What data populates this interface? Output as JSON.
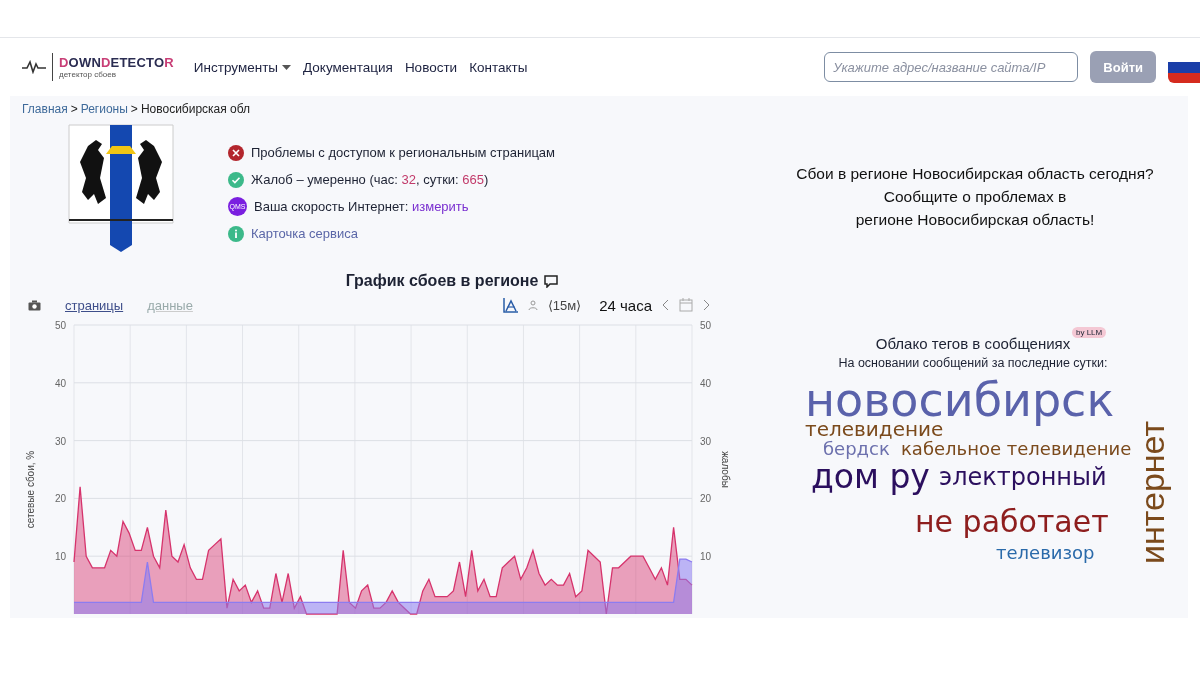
{
  "logo": {
    "name": "DOWNDETECTOR",
    "tagline": "детектор сбоев"
  },
  "nav": [
    {
      "label": "Инструменты",
      "dropdown": true
    },
    {
      "label": "Документация",
      "dropdown": false
    },
    {
      "label": "Новости",
      "dropdown": false
    },
    {
      "label": "Контакты",
      "dropdown": false
    }
  ],
  "search": {
    "placeholder": "Укажите адрес/название сайта/IP"
  },
  "login_button": "Войти",
  "breadcrumb": {
    "separator": ">",
    "items": [
      "Главная",
      "Регионы",
      "Новосибирская обл"
    ]
  },
  "status_items": [
    {
      "kind": "error",
      "label": "Проблемы с доступом к региональным страницам"
    },
    {
      "kind": "ok",
      "label": "Жалоб – умеренно (час: ",
      "hour": "32",
      "day_label": ", сутки: ",
      "day": "665",
      "close": ")"
    },
    {
      "kind": "speed",
      "icon_text": "QMS",
      "label": "Ваша скорость Интернет: ",
      "link": "измерить"
    },
    {
      "kind": "info",
      "link": "Карточка сервиса"
    }
  ],
  "chart_title": "График сбоев в регионе",
  "chart_tabs": [
    {
      "label": "страницы",
      "selected": true
    },
    {
      "label": "данные",
      "selected": false
    }
  ],
  "interval": "⟨15м⟩",
  "period": "24 часа",
  "right_axis": {
    "label": "жалобы",
    "ticks": [
      "50",
      "40",
      "30",
      "20",
      "10"
    ]
  },
  "chart_data": {
    "type": "area",
    "grid": true,
    "ylabel": "сетевые сбои, %",
    "ylim": [
      0,
      50
    ],
    "yticks": [
      10,
      20,
      30,
      40,
      50
    ],
    "series": [
      {
        "color": "#d6336c",
        "values": [
          9,
          22,
          10,
          8,
          8,
          8,
          11,
          10,
          16,
          14,
          11,
          11,
          15,
          10,
          8,
          18,
          10,
          9,
          12,
          8,
          6,
          6,
          11,
          12,
          13,
          1,
          6,
          4,
          5,
          2,
          4,
          1,
          1,
          7,
          2,
          7,
          1,
          3,
          0,
          0,
          0,
          0,
          0,
          0,
          11,
          2,
          1,
          4,
          5,
          1,
          1,
          2,
          4,
          2,
          1,
          0,
          0,
          4,
          6,
          3,
          3,
          3,
          4,
          9,
          3,
          11,
          4,
          6,
          3,
          3,
          8,
          9,
          10,
          6,
          8,
          11,
          7,
          5,
          6,
          5,
          5,
          7,
          3,
          4,
          11,
          10,
          9,
          0,
          8,
          8,
          9,
          10,
          10,
          10,
          8,
          6,
          8,
          5,
          15,
          6,
          6,
          5
        ]
      },
      {
        "color": "#8c7cf0",
        "values": [
          2,
          2,
          2,
          2,
          2,
          2,
          2,
          2,
          2,
          2,
          2,
          2,
          9,
          2,
          2,
          2,
          2,
          2,
          2,
          2,
          2,
          2,
          2,
          2,
          2,
          2,
          2,
          2,
          2,
          2,
          2,
          2,
          2,
          2,
          2,
          2,
          2,
          2,
          2,
          2,
          2,
          2,
          2,
          2,
          2,
          2,
          2,
          2,
          2,
          2,
          2,
          2,
          2,
          2,
          2,
          2,
          2,
          2,
          2,
          2,
          2,
          2,
          2,
          2,
          2,
          2,
          2,
          2,
          2,
          2,
          2,
          2,
          2,
          2,
          2,
          2,
          2,
          2,
          2,
          2,
          2,
          2,
          2,
          2,
          2,
          2,
          2,
          2,
          2,
          2,
          2,
          2,
          2,
          2,
          2,
          2,
          2,
          2,
          2,
          9.5,
          9.5,
          9
        ]
      }
    ]
  },
  "prompt_lines": [
    "Сбои в регионе Новосибирская область сегодня?",
    "Сообщите о проблемах в",
    "регионе Новосибирская область!"
  ],
  "cloud": {
    "title": "Облако тегов в сообщениях",
    "badge": "by LLM",
    "subtitle": "На основании сообщений за последние сутки:",
    "tags": [
      {
        "text": "новосибирск",
        "color": "#5a62ab",
        "vertical": false
      },
      {
        "text": "телевидение",
        "color": "#7b4a1c",
        "vertical": false
      },
      {
        "text": "бердск",
        "color": "#6c70ad",
        "vertical": false
      },
      {
        "text": "кабельное телевидение",
        "color": "#7b4a1c",
        "vertical": false
      },
      {
        "text": "дом ру",
        "color": "#2b0f5e",
        "vertical": false
      },
      {
        "text": "электронный",
        "color": "#2b0f5e",
        "vertical": false
      },
      {
        "text": "не работает",
        "color": "#8e1e1e",
        "vertical": false
      },
      {
        "text": "телевизор",
        "color": "#2a6aaa",
        "vertical": false
      },
      {
        "text": "интернет",
        "color": "#7b4a1c",
        "vertical": true
      }
    ]
  }
}
